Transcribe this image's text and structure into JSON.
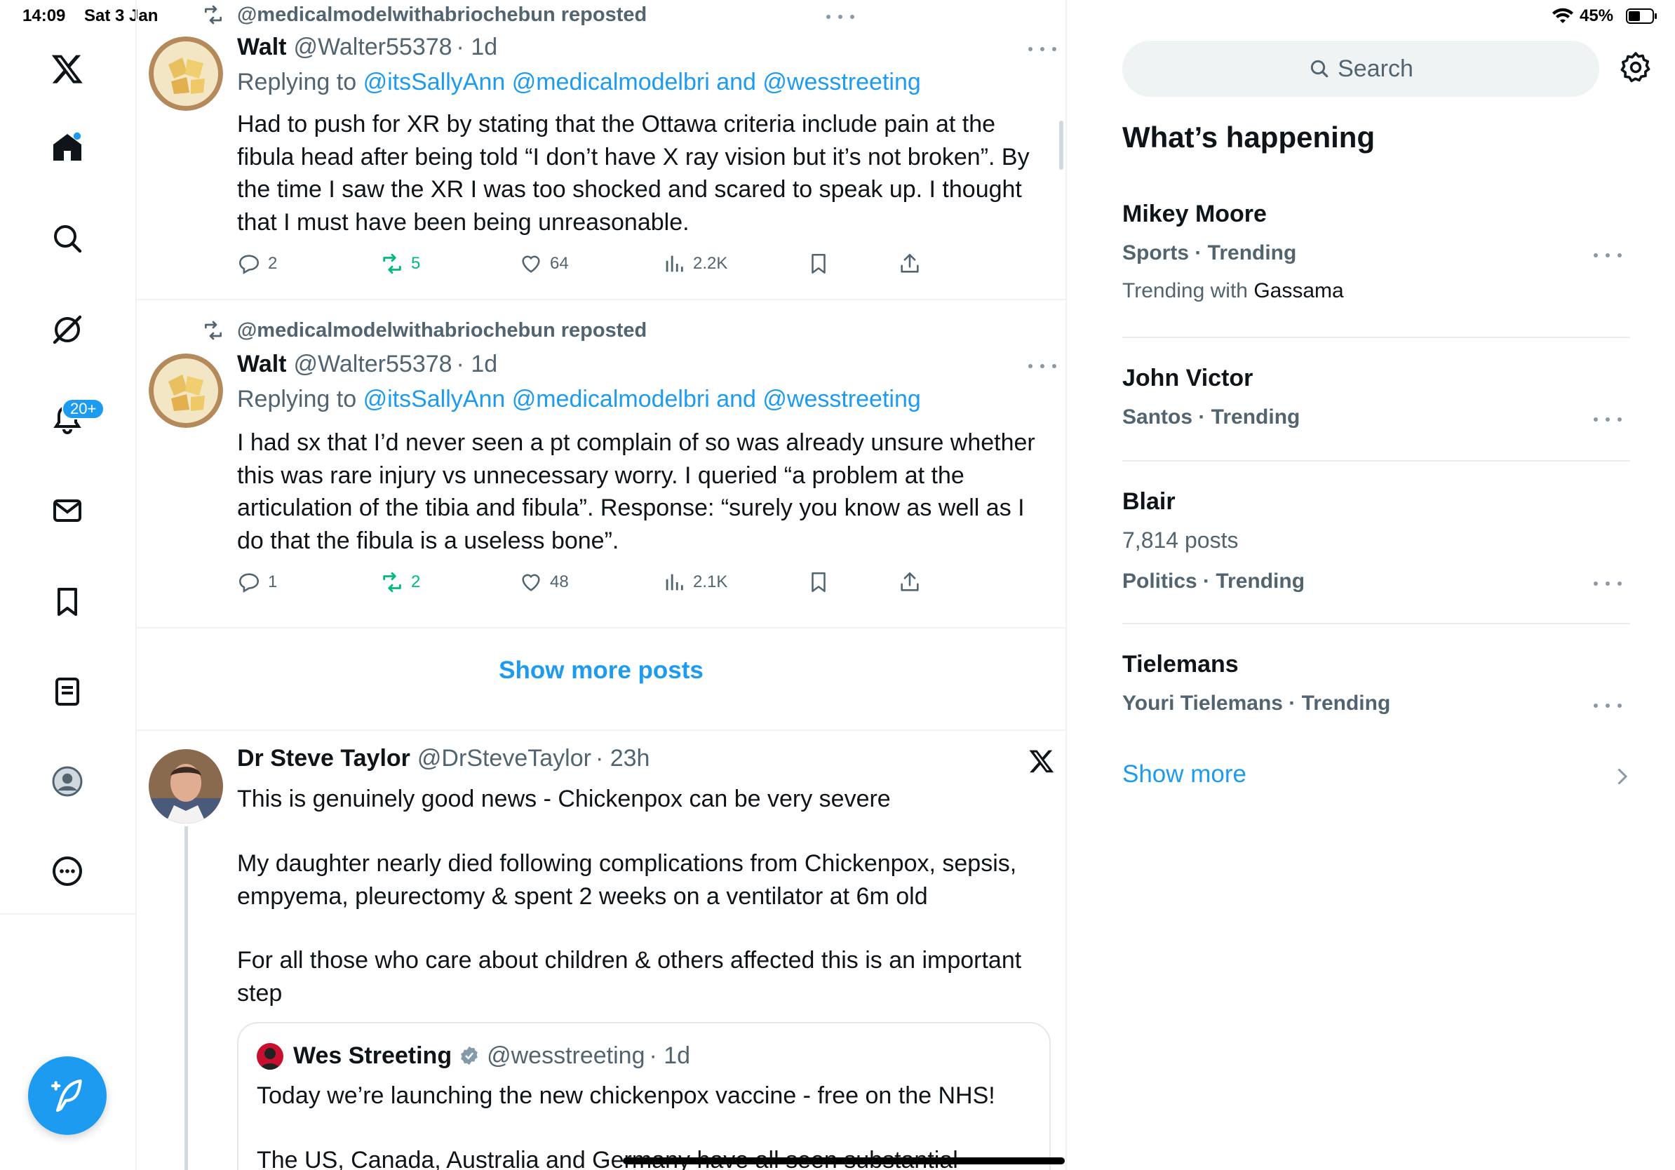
{
  "status_bar": {
    "time": "14:09",
    "date": "Sat 3 Jan",
    "battery": "45%"
  },
  "notifications_badge": "20+",
  "colors": {
    "accent": "#1d9bf0",
    "repost_green": "#00ba7c",
    "secondary_text": "#536471"
  },
  "posts": [
    {
      "repost_by": "@medicalmodelwithabriochebun reposted",
      "author": "Walt",
      "handle": "@Walter55378",
      "time": "· 1d",
      "replying_prefix": "Replying to",
      "replying_to": "@itsSallyAnn @medicalmodelbri and @wesstreeting",
      "text": "Had to push for XR by stating that the Ottawa criteria include pain at the fibula head after being told “I don’t have X ray vision but it’s not broken”. By the time I saw the XR I was too shocked and scared to speak up. I thought that I must have been being unreasonable.",
      "replies": "2",
      "reposts": "5",
      "likes": "64",
      "views": "2.2K"
    },
    {
      "repost_by": "@medicalmodelwithabriochebun reposted",
      "author": "Walt",
      "handle": "@Walter55378",
      "time": "· 1d",
      "replying_prefix": "Replying to",
      "replying_to": "@itsSallyAnn @medicalmodelbri and @wesstreeting",
      "text": "I had sx that I’d never seen a pt complain of so was already unsure whether this was rare injury vs unnecessary worry. I queried “a problem at the articulation of the tibia and fibula”. Response: “surely you know as well as I do that the fibula is a useless bone”.",
      "replies": "1",
      "reposts": "2",
      "likes": "48",
      "views": "2.1K"
    }
  ],
  "show_more_posts": "Show more posts",
  "post3": {
    "author": "Dr Steve Taylor",
    "handle": "@DrSteveTaylor",
    "time": "· 23h",
    "p1": "This is genuinely good news - Chickenpox can be very severe",
    "p2": "My daughter nearly died following complications from Chickenpox, sepsis, empyema, pleurectomy & spent 2 weeks on a ventilator at 6m old",
    "p3": "For all those who care about children & others affected this is an important step",
    "quote": {
      "author": "Wes Streeting",
      "handle": "@wesstreeting",
      "time": "· 1d",
      "p1": "Today we’re launching the new chickenpox vaccine - free on the NHS!",
      "p2": "The US, Canada, Australia and Germany have all seen substantial"
    }
  },
  "search": {
    "placeholder": "Search"
  },
  "whats_happening": "What’s happening",
  "trends": [
    {
      "title": "Mikey Moore",
      "context": "Sports · Trending",
      "sub_prefix": "Trending with",
      "sub_name": "Gassama"
    },
    {
      "title": "John Victor",
      "context": "Santos · Trending"
    },
    {
      "title": "Blair",
      "posts": "7,814 posts",
      "context": "Politics · Trending"
    },
    {
      "title": "Tielemans",
      "context": "Youri Tielemans · Trending"
    }
  ],
  "show_more": "Show more"
}
